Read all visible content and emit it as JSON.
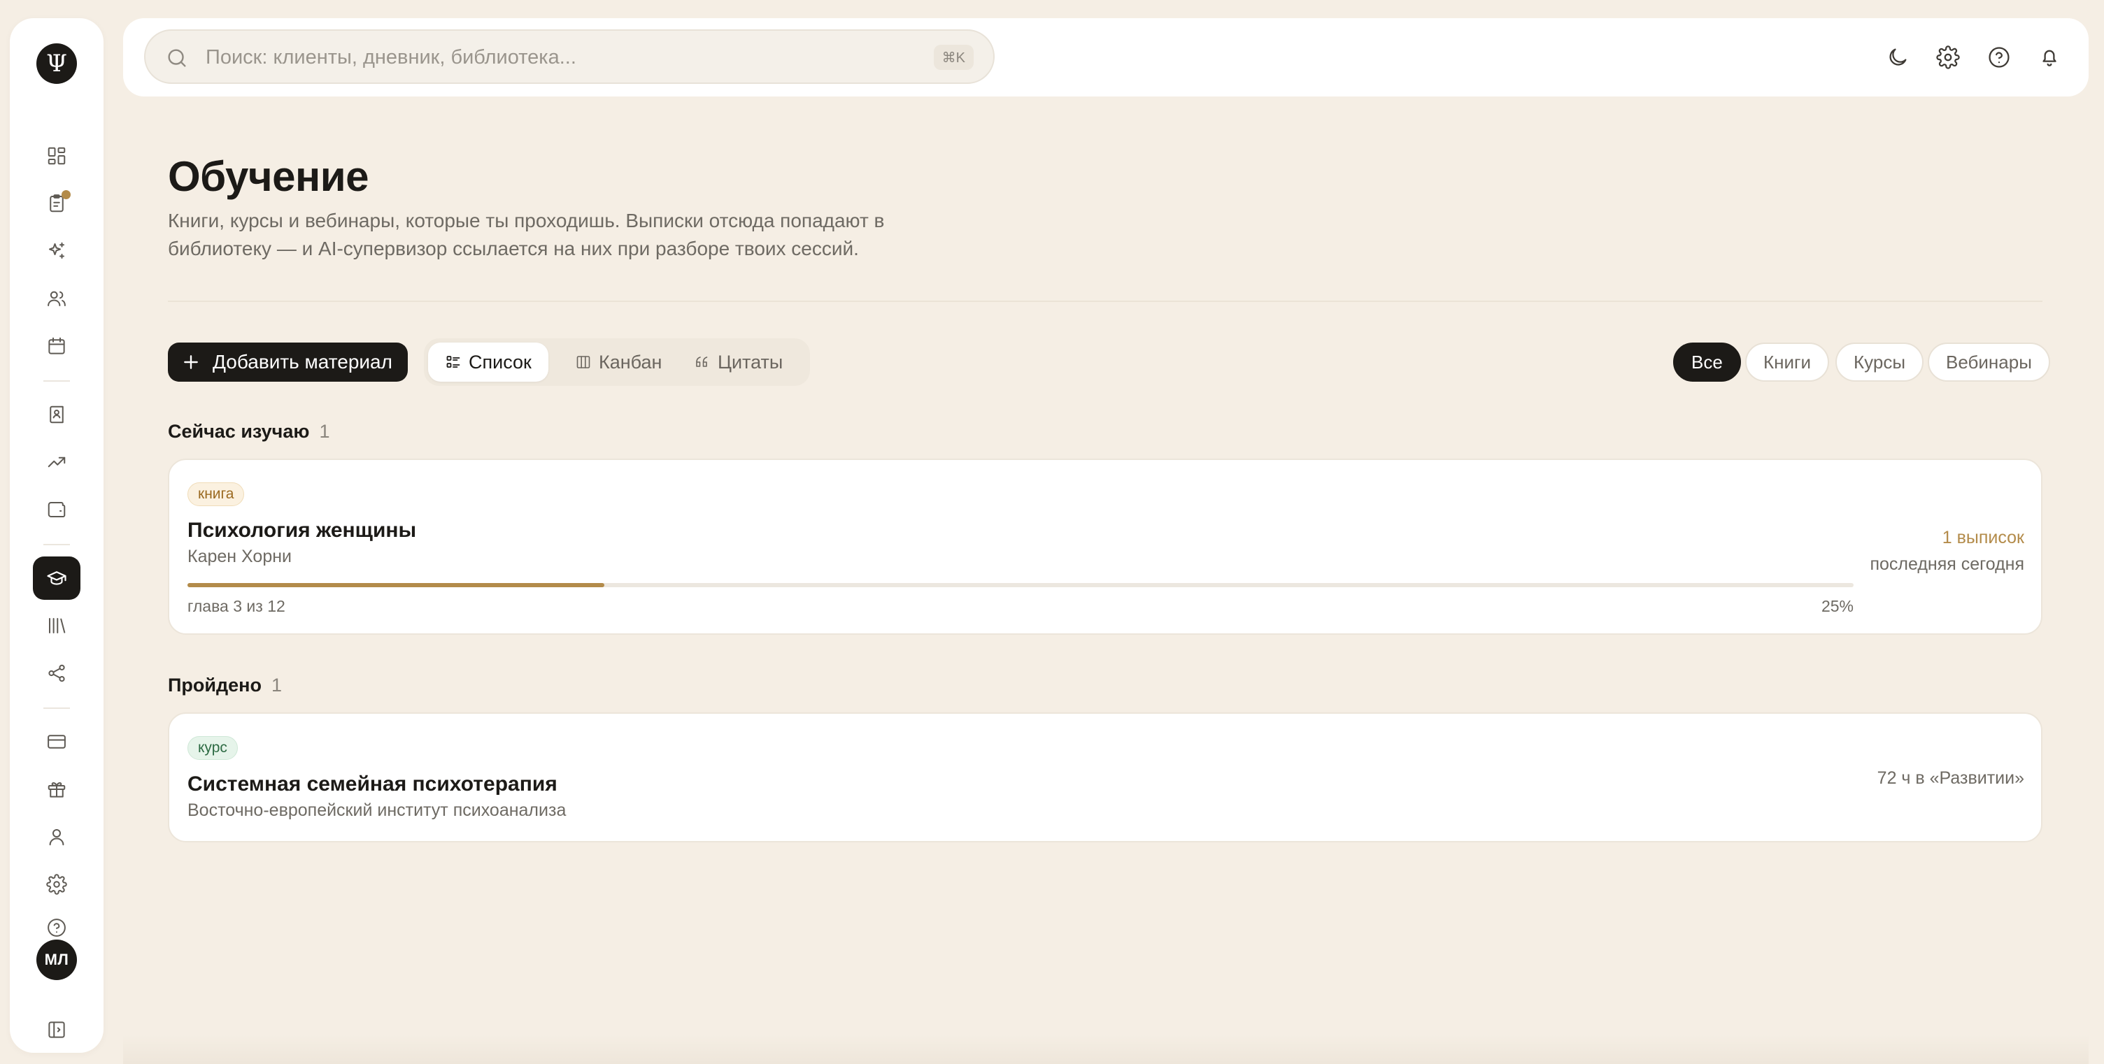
{
  "sidebar": {
    "logo": "Ψ",
    "avatar": "МЛ",
    "items": [
      {
        "name": "dashboard-icon"
      },
      {
        "name": "clipboard-icon",
        "badge": true
      },
      {
        "name": "sparkles-icon"
      },
      {
        "name": "users-icon"
      },
      {
        "name": "calendar-icon"
      },
      {
        "name": "book-user-icon"
      },
      {
        "name": "trending-up-icon"
      },
      {
        "name": "wallet-icon"
      },
      {
        "name": "graduation-cap-icon",
        "active": true
      },
      {
        "name": "library-icon"
      },
      {
        "name": "share-icon"
      },
      {
        "name": "credit-card-icon"
      },
      {
        "name": "gift-icon"
      },
      {
        "name": "user-icon"
      },
      {
        "name": "gear-icon"
      },
      {
        "name": "help-icon"
      },
      {
        "name": "panel-toggle-icon"
      }
    ]
  },
  "search": {
    "placeholder": "Поиск: клиенты, дневник, библиотека...",
    "shortcut": "⌘K"
  },
  "topbar": {
    "icons": [
      "moon-icon",
      "gear-icon",
      "help-icon",
      "bell-icon"
    ]
  },
  "page": {
    "title": "Обучение",
    "subtitle": "Книги, курсы и вебинары, которые ты проходишь. Выписки отсюда попадают в библиотеку — и AI-супервизор ссылается на них при разборе твоих сессий."
  },
  "toolbar": {
    "add_label": "Добавить материал",
    "views": [
      {
        "label": "Список",
        "active": true
      },
      {
        "label": "Канбан",
        "active": false
      },
      {
        "label": "Цитаты",
        "active": false
      }
    ],
    "filters": [
      {
        "label": "Все",
        "active": true
      },
      {
        "label": "Книги",
        "active": false
      },
      {
        "label": "Курсы",
        "active": false
      },
      {
        "label": "Вебинары",
        "active": false
      }
    ]
  },
  "sections": {
    "current": {
      "title": "Сейчас изучаю",
      "count": "1",
      "item": {
        "tag": "книга",
        "title": "Психология женщины",
        "author": "Карен Хорни",
        "progress_fraction": 0.25,
        "progress_text": "глава 3 из 12",
        "progress_percent": "25%",
        "extracts": "1 выписок",
        "last": "последняя сегодня"
      }
    },
    "done": {
      "title": "Пройдено",
      "count": "1",
      "item": {
        "tag": "курс",
        "title": "Системная семейная психотерапия",
        "author": "Восточно-европейский институт психоанализа",
        "hours": "72 ч в «Развитии»"
      }
    }
  },
  "colors": {
    "background": "#f5eee4",
    "accent": "#b38b4a",
    "dark": "#1c1a17"
  }
}
